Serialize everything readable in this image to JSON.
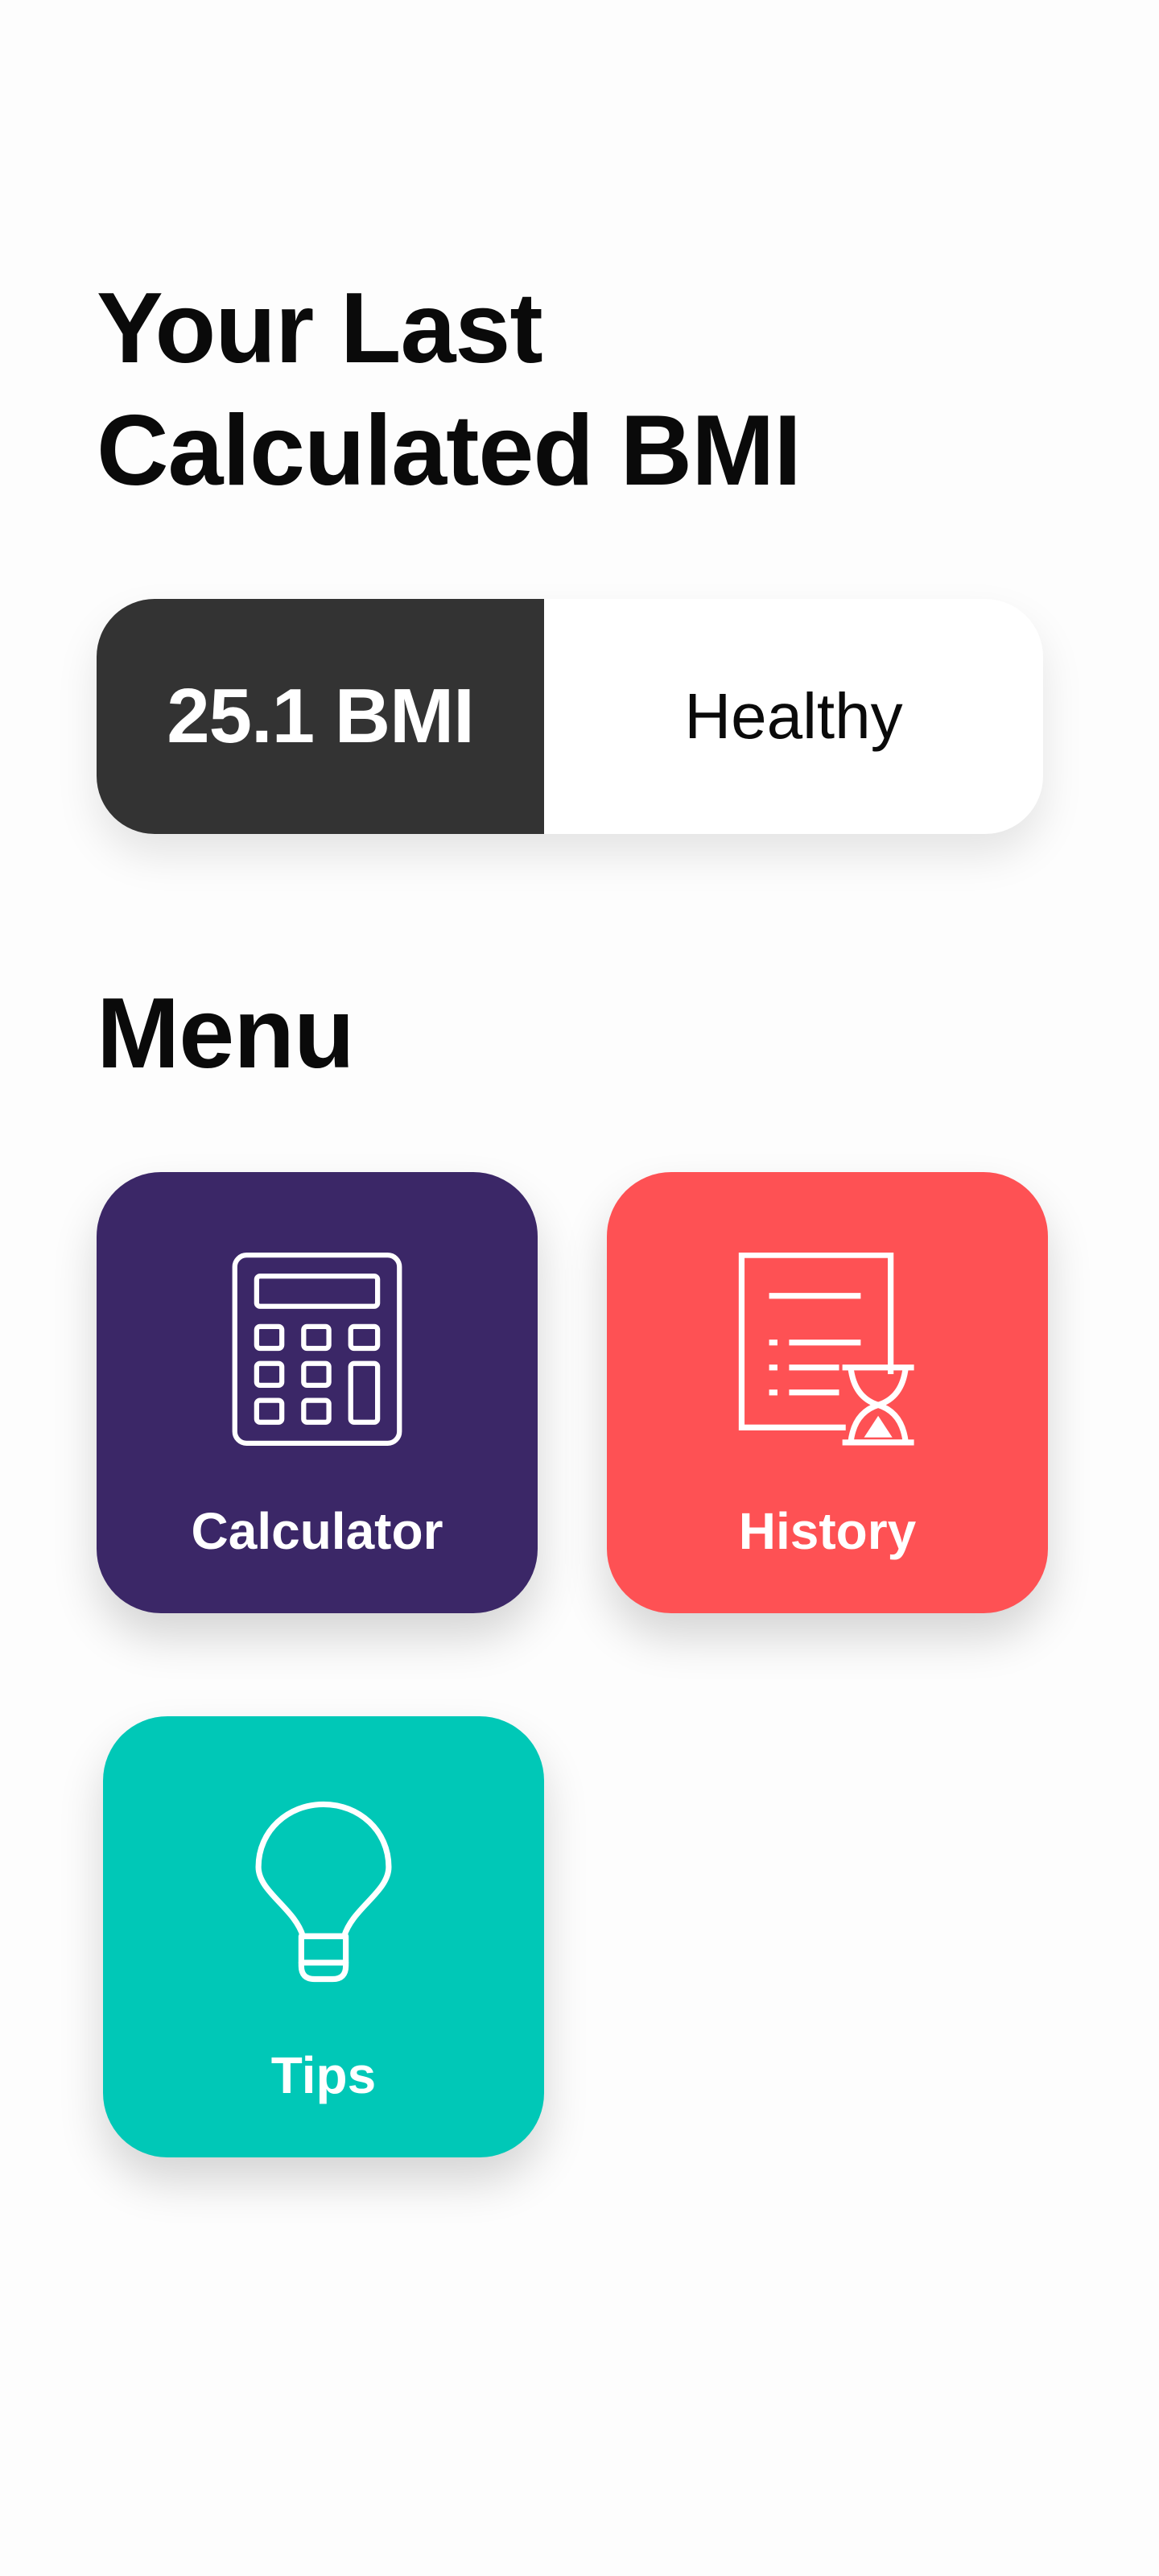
{
  "header": {
    "title_line1": "Your Last",
    "title_line2": "Calculated BMI"
  },
  "bmi": {
    "value_label": "25.1 BMI",
    "status": "Healthy"
  },
  "menu": {
    "heading": "Menu",
    "items": [
      {
        "label": "Calculator",
        "icon": "calculator-icon",
        "color": "#3b2767"
      },
      {
        "label": "History",
        "icon": "history-icon",
        "color": "#fe5154"
      },
      {
        "label": "Tips",
        "icon": "lightbulb-icon",
        "color": "#00c8b7"
      }
    ]
  },
  "colors": {
    "bmi_value_bg": "#333333",
    "background": "#fdfdfd"
  }
}
